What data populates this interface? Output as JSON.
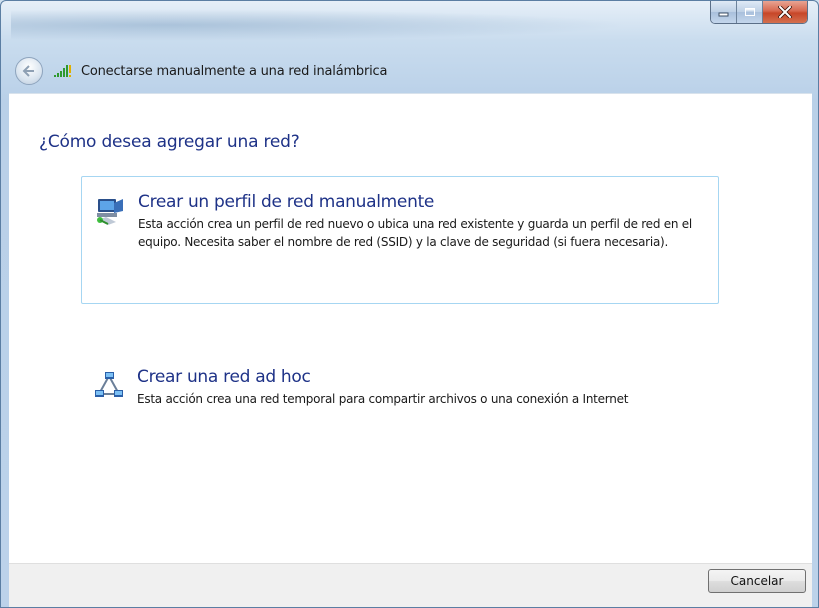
{
  "window": {
    "title": "Conectarse manualmente a una red inalámbrica",
    "accent": "#1e3287"
  },
  "main": {
    "heading": "¿Cómo desea agregar una red?",
    "options": [
      {
        "icon": "network-profile-icon",
        "title": "Crear un perfil de red manualmente",
        "description": "Esta acción crea un perfil de red nuevo o ubica una red existente y guarda un perfil de red en el equipo. Necesita saber el nombre de red (SSID) y la clave de seguridad (si fuera necesaria)."
      },
      {
        "icon": "adhoc-network-icon",
        "title": "Crear una red ad hoc",
        "description": "Esta acción crea una red temporal para compartir archivos o una conexión a Internet"
      }
    ]
  },
  "footer": {
    "cancel_label": "Cancelar"
  }
}
